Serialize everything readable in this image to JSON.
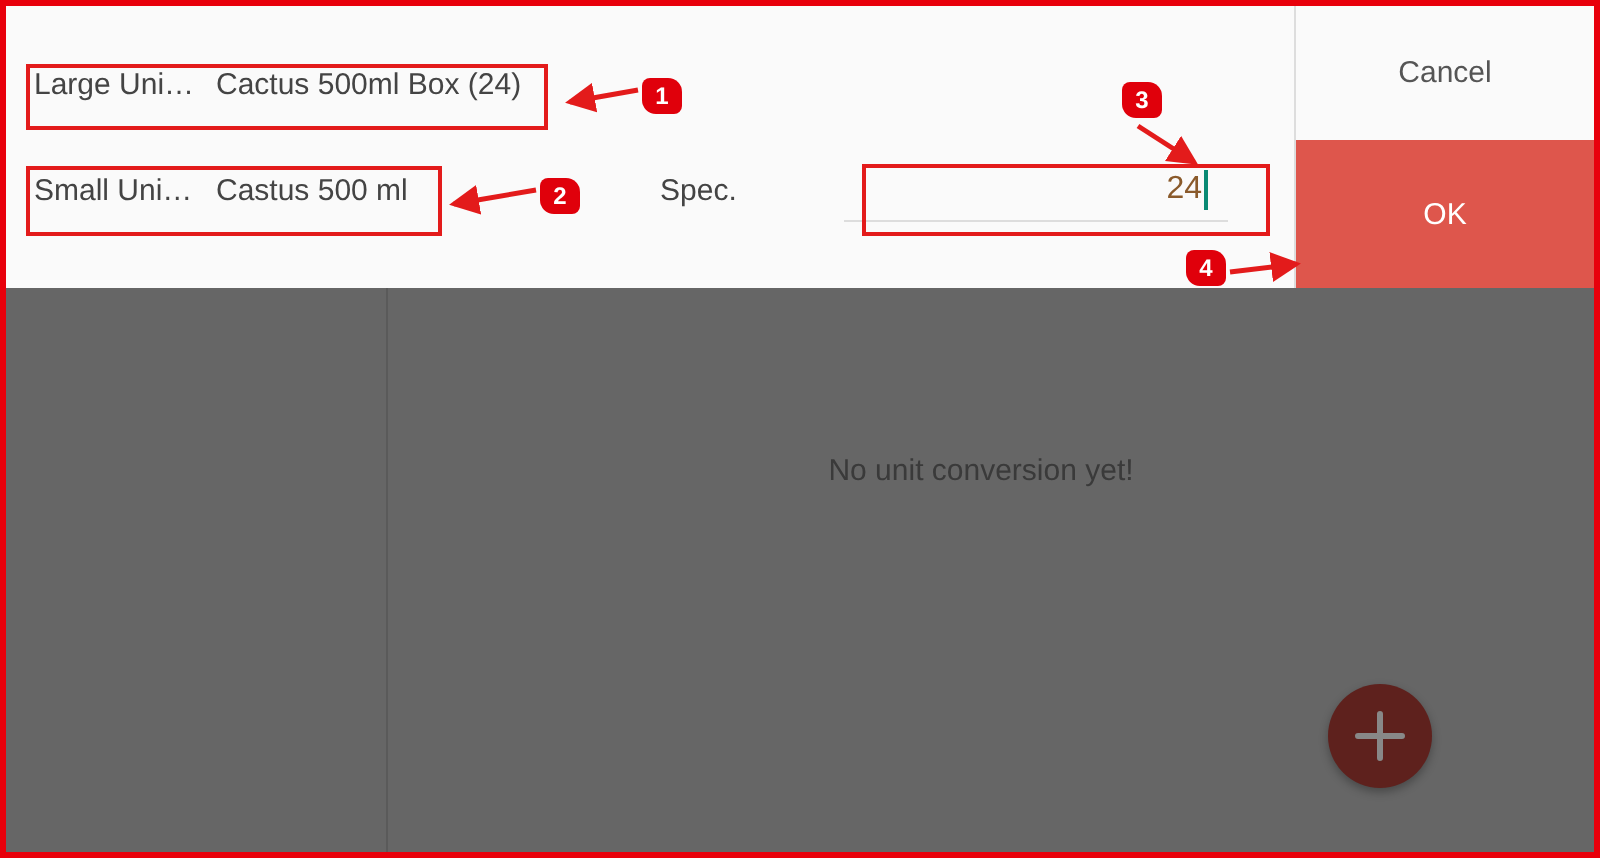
{
  "dialog": {
    "rows": [
      {
        "label": "Large Uni…",
        "value": "Cactus 500ml Box (24)"
      },
      {
        "label": "Small Uni…",
        "value": "Castus 500 ml"
      }
    ],
    "spec": {
      "label": "Spec.",
      "value": "24",
      "focused": true
    },
    "buttons": [
      {
        "label": "Cancel",
        "kind": "cancel"
      },
      {
        "label": "OK",
        "kind": "ok"
      }
    ]
  },
  "background": {
    "empty_message": "No unit conversion yet!"
  },
  "annotations": [
    "1",
    "2",
    "3",
    "4"
  ]
}
